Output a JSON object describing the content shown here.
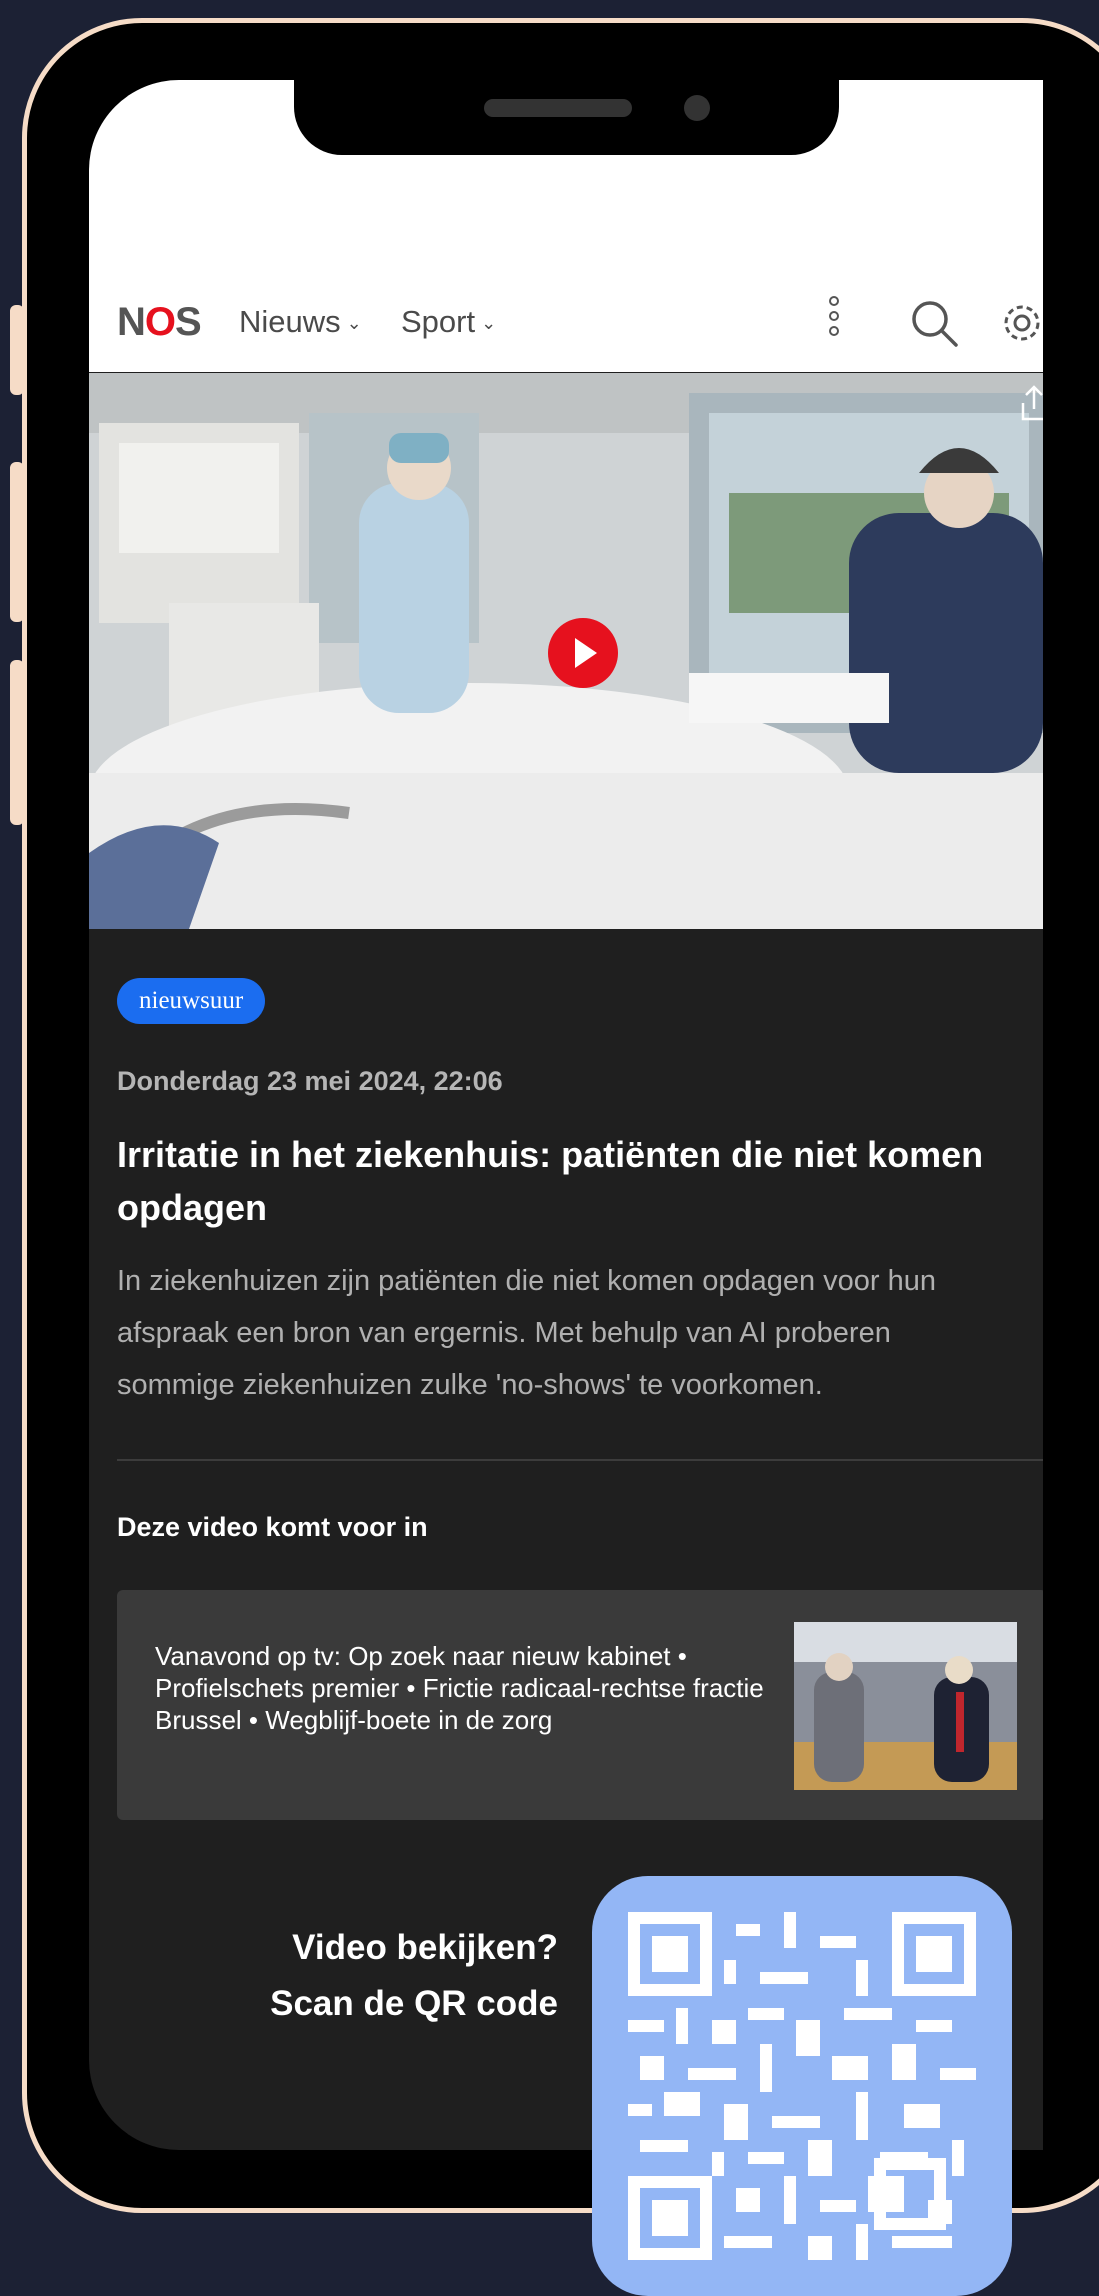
{
  "nav": {
    "logo_prefix": "N",
    "logo_o": "O",
    "logo_suffix": "S",
    "items": [
      {
        "label": "Nieuws"
      },
      {
        "label": "Sport"
      }
    ]
  },
  "article": {
    "badge": "nieuwsuur",
    "date": "Donderdag 23 mei 2024, 22:06",
    "headline": "Irritatie in het ziekenhuis: patiënten die niet komen opdagen",
    "summary_lines": [
      "In ziekenhuizen zijn patiënten die niet komen opdagen voor hun",
      "afspraak een bron van ergernis. Met behulp van AI proberen",
      "sommige ziekenhuizen zulke 'no-shows' te voorkomen."
    ],
    "related_title": "Deze video komt voor in",
    "related_card": "Vanavond op tv: Op zoek naar nieuw kabinet • Profielschets premier • Frictie radicaal-rechtse fractie Brussel • Wegblijf-boete in de zorg"
  },
  "cta": {
    "line1": "Video bekijken?",
    "line2": "Scan de QR code"
  },
  "colors": {
    "background": "#1c2134",
    "frame": "#f6dcc7",
    "accent_red": "#e6111e",
    "badge_blue": "#1b6df0",
    "qr_bg": "#93b6f5"
  }
}
